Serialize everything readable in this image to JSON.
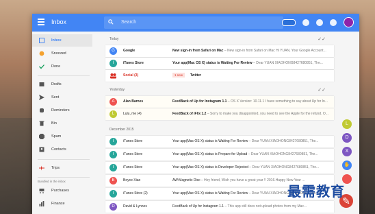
{
  "app": {
    "title": "Inbox"
  },
  "search": {
    "placeholder": "Search"
  },
  "sidebar": {
    "items": [
      {
        "label": "Inbox"
      },
      {
        "label": "Snoozed"
      },
      {
        "label": "Done"
      },
      {
        "label": "Drafts"
      },
      {
        "label": "Sent"
      },
      {
        "label": "Reminders"
      },
      {
        "label": "Bin"
      },
      {
        "label": "Spam"
      },
      {
        "label": "Contacts"
      },
      {
        "label": "Trips"
      },
      {
        "label": "Purchases"
      },
      {
        "label": "Finance"
      }
    ],
    "bundled_label": "Bundled in the inbox"
  },
  "sections": {
    "today": "Today",
    "yesterday": "Yesterday",
    "december": "December 2015"
  },
  "rows": {
    "today": [
      {
        "sender": "Google",
        "subject": "New sign-in from Safari on Mac",
        "snippet": " – New sign-in from Safari on Mac Hi YUAN, Your Google Account..."
      },
      {
        "sender": "iTunes Store",
        "subject": "Your app(Mac OS X) status is Waiting For Review",
        "snippet": " – Dear YUAN XIAOHONG8427680851, The..."
      },
      {
        "sender": "Social (3)",
        "badge": "1 new",
        "bundle": "Twitter"
      }
    ],
    "yesterday": [
      {
        "sender": "Alan Barnes",
        "subject": "FeedBack of Up for Instagram 1.1",
        "snippet": " – OS X Version: 10.11.1 I have something to say about Up for In..."
      },
      {
        "sender": "Lulu, me (4)",
        "subject": "FeedBack of iFlix 1.2",
        "snippet": " – Sorry to make you disappointed, you need to see the Apple for the refund. O..."
      }
    ],
    "december": [
      {
        "sender": "iTunes Store",
        "subject": "Your app(Mac OS X) status is Waiting For Review",
        "snippet": " – Dear YUAN XIAOHONG8427680851, The..."
      },
      {
        "sender": "iTunes Store",
        "subject": "Your app(Mac OS X) status is Prepare for Upload",
        "snippet": " – Dear YUAN XIAOHONG8427680851, The..."
      },
      {
        "sender": "iTunes Store",
        "subject": "Your app(Mac OS X) status is Developer Rejected",
        "snippet": " – Dear YUAN XIAOHONG8427680851, The..."
      },
      {
        "sender": "Boyce Xiao",
        "subject": "AW:Magnetic Disc",
        "snippet": " – Hey friend, Wish you have a great year !! 2016.Happy New Year ..."
      },
      {
        "sender": "iTunes Store (2)",
        "subject": "Your app(Mac OS X) status is Waiting For Review",
        "snippet": " – Dear YUAN XIAOHONG8427680851, The..."
      },
      {
        "sender": "David & Lynnes",
        "subject": "FeedBack of Up for Instagram 1.1",
        "snippet": " – This app still does not upload photos from my Mac..."
      }
    ]
  },
  "avatars": [
    "G",
    "I",
    "",
    "A",
    "L",
    "I",
    "I",
    "I",
    "B",
    "I",
    "D"
  ],
  "fabs": [
    "L",
    "D",
    "X",
    "",
    "",
    ""
  ],
  "watermark": {
    "text": "最需教育"
  },
  "colors": {
    "accent": "#4285f4",
    "fab_main": "#db4437",
    "social": "#d93025"
  }
}
